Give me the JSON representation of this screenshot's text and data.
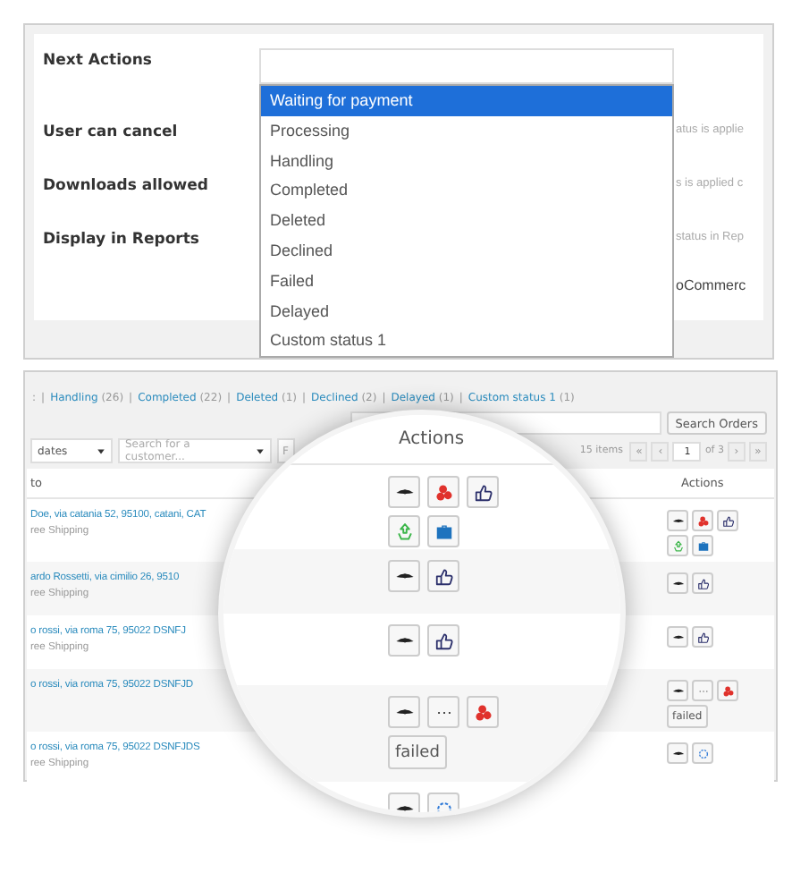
{
  "settings": {
    "rows": [
      {
        "label": "Next Actions",
        "hint": ""
      },
      {
        "label": "User can cancel",
        "hint": "atus is applie"
      },
      {
        "label": "Downloads allowed",
        "hint": "s is applied c"
      },
      {
        "label": "Display in Reports",
        "hint": "status in Rep"
      },
      {
        "label": "",
        "hint": "oCommerc"
      }
    ],
    "dropdown": {
      "options": [
        {
          "label": "Waiting for payment",
          "selected": true
        },
        {
          "label": "Processing",
          "selected": false
        },
        {
          "label": "Handling",
          "selected": false
        },
        {
          "label": "Completed",
          "selected": false
        },
        {
          "label": "Deleted",
          "selected": false
        },
        {
          "label": "Declined",
          "selected": false
        },
        {
          "label": "Failed",
          "selected": false
        },
        {
          "label": "Delayed",
          "selected": false
        },
        {
          "label": "Custom status 1",
          "selected": false
        }
      ]
    }
  },
  "orders": {
    "status_lead": ":",
    "status_links": [
      {
        "sep": "|",
        "label": "Handling",
        "count": "(26)"
      },
      {
        "sep": "|",
        "label": "Completed",
        "count": "(22)"
      },
      {
        "sep": "|",
        "label": "Deleted",
        "count": "(1)"
      },
      {
        "sep": "|",
        "label": "Declined",
        "count": "(2)"
      },
      {
        "sep": "|",
        "label": "Delayed",
        "count": "(1)"
      },
      {
        "sep": "|",
        "label": "Custom status 1",
        "count": "(1)"
      }
    ],
    "search_button": "Search Orders",
    "filters": {
      "date": "dates",
      "customer_placeholder": "Search for a customer...",
      "field_3": "F"
    },
    "pagination": {
      "items": "15 items",
      "first": "«",
      "prev": "‹",
      "page": "1",
      "of": "of 3",
      "next": "›",
      "last": "»"
    },
    "columns": [
      "to",
      "Actions"
    ],
    "rows": [
      {
        "address": "Doe, via catania 52, 95100, catani, CAT",
        "shipping": "ree Shipping",
        "actions": [
          {
            "kind": "view"
          },
          {
            "kind": "circles"
          },
          {
            "kind": "approve"
          },
          {
            "kind": "arrows"
          },
          {
            "kind": "briefcase"
          }
        ]
      },
      {
        "address": "ardo Rossetti, via cimilio 26, 9510",
        "shipping": "ree Shipping",
        "actions": [
          {
            "kind": "view"
          },
          {
            "kind": "approve"
          }
        ]
      },
      {
        "address": "o rossi, via roma 75, 95022 DSNFJ",
        "shipping": "ree Shipping",
        "actions": [
          {
            "kind": "view"
          },
          {
            "kind": "approve"
          }
        ]
      },
      {
        "address": "o rossi, via roma 75, 95022 DSNFJD",
        "shipping": "",
        "actions": [
          {
            "kind": "view"
          },
          {
            "kind": "dots"
          },
          {
            "kind": "circles"
          },
          {
            "kind": "label",
            "label": "failed"
          }
        ]
      },
      {
        "address": "o rossi, via roma 75, 95022 DSNFJDS",
        "shipping": "ree Shipping",
        "actions": [
          {
            "kind": "view"
          },
          {
            "kind": "spinner"
          }
        ]
      }
    ]
  },
  "magnifier": {
    "header": "Actions",
    "rows": [
      {
        "actions": [
          {
            "kind": "view"
          },
          {
            "kind": "circles"
          },
          {
            "kind": "approve"
          },
          {
            "kind": "arrows"
          },
          {
            "kind": "briefcase"
          }
        ]
      },
      {
        "actions": [
          {
            "kind": "view"
          },
          {
            "kind": "approve"
          }
        ]
      },
      {
        "actions": [
          {
            "kind": "view"
          },
          {
            "kind": "approve"
          }
        ]
      },
      {
        "actions": [
          {
            "kind": "view"
          },
          {
            "kind": "dots"
          },
          {
            "kind": "circles"
          },
          {
            "kind": "label",
            "label": "failed"
          }
        ]
      },
      {
        "actions": [
          {
            "kind": "view"
          },
          {
            "kind": "spinner"
          }
        ]
      }
    ]
  }
}
